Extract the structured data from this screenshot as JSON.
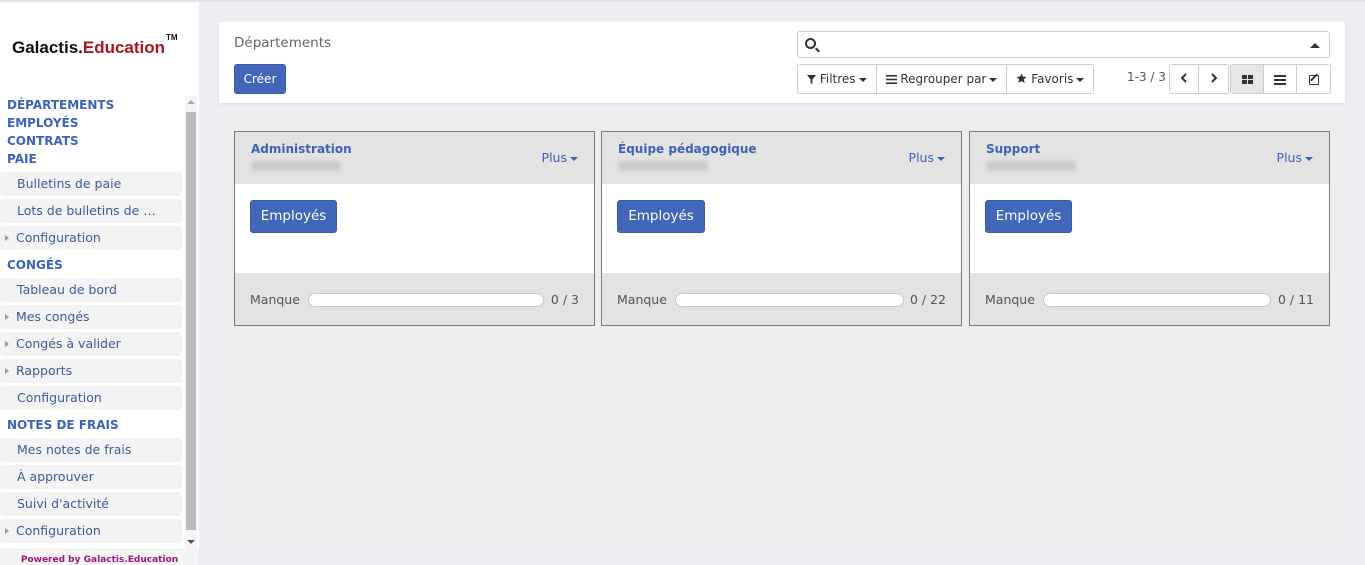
{
  "brand": {
    "name_part1": "Galactis.",
    "name_part2": "Education",
    "trademark": "TM",
    "powered_by": "Powered by Galactis.Education"
  },
  "sidebar": {
    "sections": [
      {
        "label": "DÉPARTEMENTS"
      },
      {
        "label": "EMPLOYÉS"
      },
      {
        "label": "CONTRATS"
      },
      {
        "label": "PAIE",
        "items": [
          {
            "label": "Bulletins de paie",
            "expandable": false
          },
          {
            "label": "Lots de bulletins de …",
            "expandable": false
          },
          {
            "label": "Configuration",
            "expandable": true
          }
        ]
      },
      {
        "label": "CONGÉS",
        "items": [
          {
            "label": "Tableau de bord",
            "expandable": false
          },
          {
            "label": "Mes congés",
            "expandable": true
          },
          {
            "label": "Congés à valider",
            "expandable": true
          },
          {
            "label": "Rapports",
            "expandable": true
          },
          {
            "label": "Configuration",
            "expandable": false
          }
        ]
      },
      {
        "label": "NOTES DE FRAIS",
        "items": [
          {
            "label": "Mes notes de frais",
            "expandable": false
          },
          {
            "label": "À approuver",
            "expandable": false
          },
          {
            "label": "Suivi d'activité",
            "expandable": false
          },
          {
            "label": "Configuration",
            "expandable": true
          }
        ]
      }
    ]
  },
  "control_panel": {
    "breadcrumb": "Départements",
    "create_label": "Créer",
    "search": {
      "value": "",
      "placeholder": ""
    },
    "filters_label": "Filtres",
    "groupby_label": "Regrouper par",
    "favorites_label": "Favoris",
    "pager": "1-3 / 3",
    "prev_icon": "chevron-left-icon",
    "next_icon": "chevron-right-icon",
    "views": [
      {
        "name": "kanban",
        "icon": "kanban-icon",
        "active": true
      },
      {
        "name": "list",
        "icon": "list-icon",
        "active": false
      },
      {
        "name": "form",
        "icon": "edit-icon",
        "active": false
      }
    ]
  },
  "departments": [
    {
      "name": "Administration",
      "manager": "[blurred]",
      "more_label": "Plus",
      "button_label": "Employés",
      "progress_label": "Manque",
      "progress_value": 0,
      "progress_max": 3,
      "progress_text": "0 / 3"
    },
    {
      "name": "Équipe pédagogique",
      "manager": "[blurred]",
      "more_label": "Plus",
      "button_label": "Employés",
      "progress_label": "Manque",
      "progress_value": 0,
      "progress_max": 22,
      "progress_text": "0 / 22"
    },
    {
      "name": "Support",
      "manager": "[blurred]",
      "more_label": "Plus",
      "button_label": "Employés",
      "progress_label": "Manque",
      "progress_value": 0,
      "progress_max": 11,
      "progress_text": "0 / 11"
    }
  ],
  "colors": {
    "accent": "#4266ba",
    "link": "#3d62b8",
    "brand_red": "#a8161b",
    "powered": "#a0167f"
  }
}
